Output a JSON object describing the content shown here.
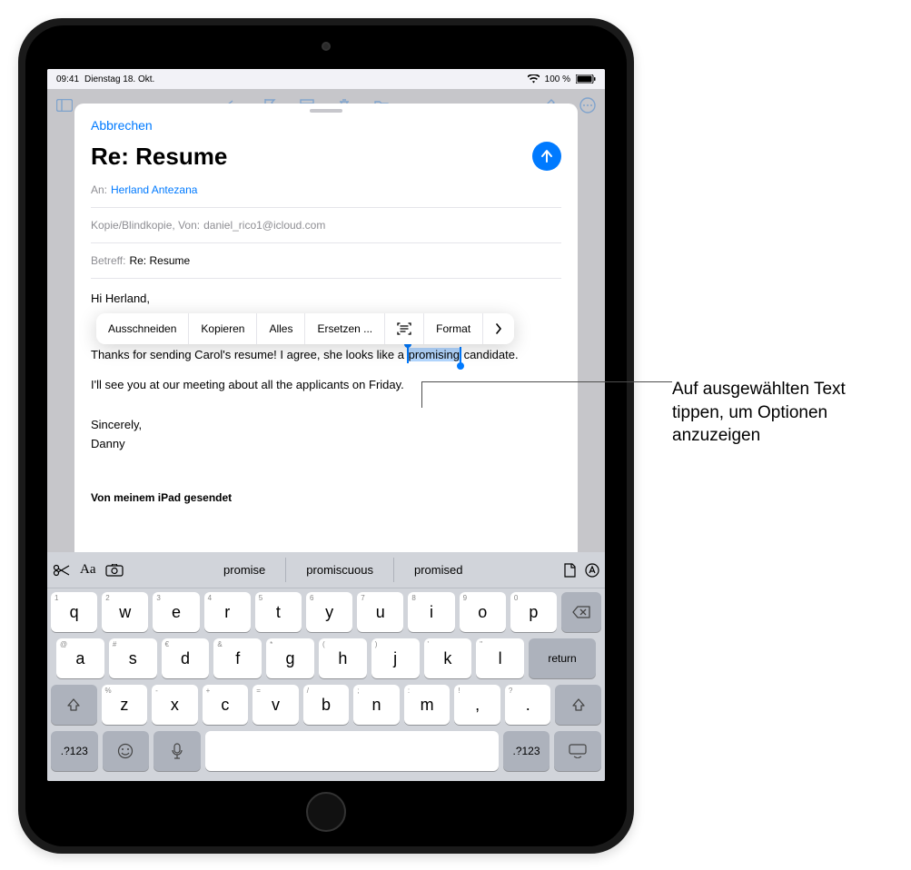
{
  "status": {
    "time": "09:41",
    "date": "Dienstag 18. Okt.",
    "battery": "100 %"
  },
  "compose": {
    "cancel": "Abbrechen",
    "title": "Re: Resume",
    "toLabel": "An:",
    "toValue": "Herland Antezana",
    "ccLabel": "Kopie/Blindkopie, Von:",
    "ccValue": "daniel_rico1@icloud.com",
    "subjectLabel": "Betreff:",
    "subjectValue": "Re: Resume",
    "body": {
      "greeting": "Hi Herland,",
      "line1a": "Thanks for sending Carol's resume! I agree, she looks like a ",
      "selected": "promising",
      "line1b": " candidate.",
      "line2": "I'll see you at our meeting about all the applicants on Friday.",
      "closing1": "Sincerely,",
      "closing2": "Danny",
      "sent": "Von meinem iPad gesendet"
    }
  },
  "editMenu": {
    "cut": "Ausschneiden",
    "copy": "Kopieren",
    "all": "Alles",
    "replace": "Ersetzen ...",
    "format": "Format"
  },
  "suggestions": [
    "promise",
    "promiscuous",
    "promised"
  ],
  "keys": {
    "row1": [
      {
        "main": "q",
        "sub": "1"
      },
      {
        "main": "w",
        "sub": "2"
      },
      {
        "main": "e",
        "sub": "3"
      },
      {
        "main": "r",
        "sub": "4"
      },
      {
        "main": "t",
        "sub": "5"
      },
      {
        "main": "y",
        "sub": "6"
      },
      {
        "main": "u",
        "sub": "7"
      },
      {
        "main": "i",
        "sub": "8"
      },
      {
        "main": "o",
        "sub": "9"
      },
      {
        "main": "p",
        "sub": "0"
      }
    ],
    "row2": [
      {
        "main": "a",
        "sub": "@"
      },
      {
        "main": "s",
        "sub": "#"
      },
      {
        "main": "d",
        "sub": "€"
      },
      {
        "main": "f",
        "sub": "&"
      },
      {
        "main": "g",
        "sub": "*"
      },
      {
        "main": "h",
        "sub": "("
      },
      {
        "main": "j",
        "sub": ")"
      },
      {
        "main": "k",
        "sub": "'"
      },
      {
        "main": "l",
        "sub": "\""
      }
    ],
    "returnKey": "return",
    "row3": [
      {
        "main": "z",
        "sub": "%"
      },
      {
        "main": "x",
        "sub": "-"
      },
      {
        "main": "c",
        "sub": "+"
      },
      {
        "main": "v",
        "sub": "="
      },
      {
        "main": "b",
        "sub": "/"
      },
      {
        "main": "n",
        "sub": ";"
      },
      {
        "main": "m",
        "sub": ":"
      },
      {
        "main": ",",
        "sub": "!"
      },
      {
        "main": ".",
        "sub": "?"
      }
    ],
    "numKey": ".?123"
  },
  "callout": "Auf ausgewählten Text tippen, um Optionen anzuzeigen"
}
